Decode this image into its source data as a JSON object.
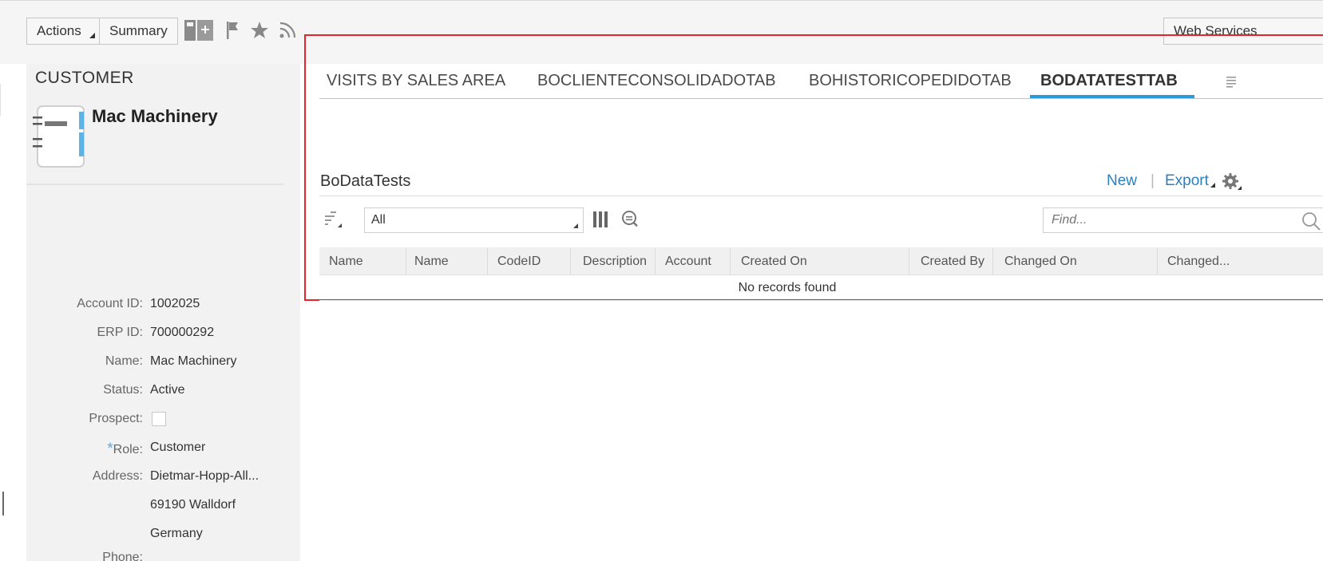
{
  "toolbar": {
    "actions_label": "Actions",
    "summary_label": "Summary",
    "web_services_label": "Web Services",
    "icons": [
      "add-table-icon",
      "flag-icon",
      "star-icon",
      "rss-icon"
    ]
  },
  "customer": {
    "section_title": "CUSTOMER",
    "name": "Mac Machinery",
    "icon": "customer-card-icon",
    "fields": {
      "account_id": {
        "label": "Account ID:",
        "value": "1002025"
      },
      "erp_id": {
        "label": "ERP ID:",
        "value": "700000292"
      },
      "name": {
        "label": "Name:",
        "value": "Mac Machinery"
      },
      "status": {
        "label": "Status:",
        "value": "Active"
      },
      "prospect": {
        "label": "Prospect:",
        "checked": false
      },
      "role": {
        "label": "Role:",
        "required_mark": "*",
        "value": "Customer"
      },
      "address": {
        "label": "Address:",
        "lines": [
          "Dietmar-Hopp-All...",
          "69190 Walldorf",
          "Germany"
        ]
      },
      "phone": {
        "label": "Phone:",
        "value": ""
      }
    }
  },
  "tabs": [
    {
      "label": "VISITS BY SALES AREA",
      "active": false
    },
    {
      "label": "BOCLIENTECONSOLIDADOTAB",
      "active": false
    },
    {
      "label": "BOHISTORICOPEDIDOTAB",
      "active": false
    },
    {
      "label": "BODATATESTTAB",
      "active": true
    }
  ],
  "list": {
    "title": "BoDataTests",
    "new_label": "New",
    "separator": "|",
    "export_label": "Export",
    "filter_value": "All",
    "find_placeholder": "Find...",
    "columns": [
      "Name",
      "Name",
      "CodeID",
      "Description",
      "Account",
      "Created On",
      "Created By",
      "Changed On",
      "Changed..."
    ],
    "empty_message": "No records found"
  },
  "colors": {
    "accent": "#2a9ad8",
    "link": "#2a7fc0",
    "highlight_border": "#e8232a",
    "required_star": "#5aa8dd"
  }
}
